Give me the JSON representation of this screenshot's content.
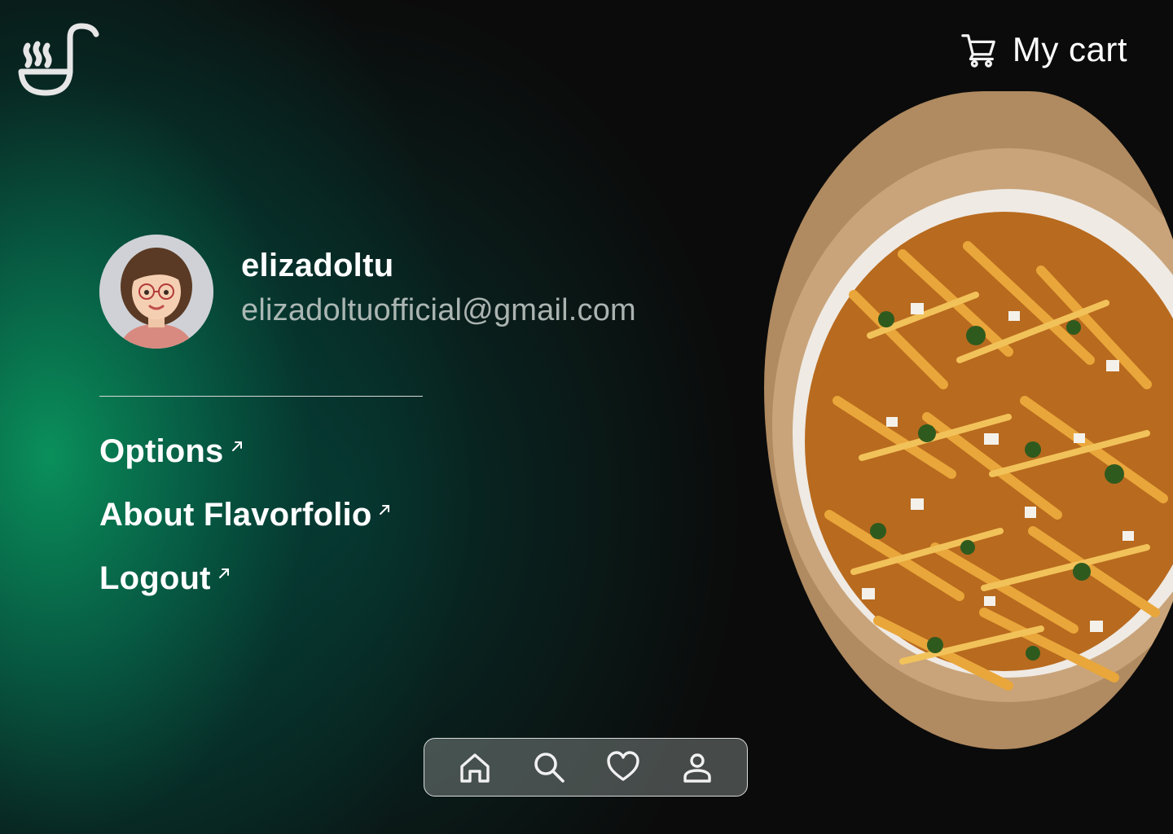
{
  "app": {
    "logo_icon": "ladle-steam-icon",
    "accent_color": "#0a965f",
    "background_color": "#0b0b0b"
  },
  "header": {
    "cart_icon": "cart-icon",
    "cart_label": "My cart"
  },
  "profile": {
    "username": "elizadoltu",
    "email": "elizadoltuofficial@gmail.com",
    "avatar_icon": "avatar"
  },
  "menu": {
    "items": [
      {
        "label": "Options",
        "icon": "external-link-icon"
      },
      {
        "label": "About Flavorfolio",
        "icon": "external-link-icon"
      },
      {
        "label": "Logout",
        "icon": "external-link-icon"
      }
    ]
  },
  "bottom_nav": {
    "items": [
      {
        "icon": "home-icon"
      },
      {
        "icon": "search-icon"
      },
      {
        "icon": "heart-icon"
      },
      {
        "icon": "user-icon"
      }
    ]
  },
  "hero_image": {
    "subject": "loaded-fries-bowl-image"
  }
}
